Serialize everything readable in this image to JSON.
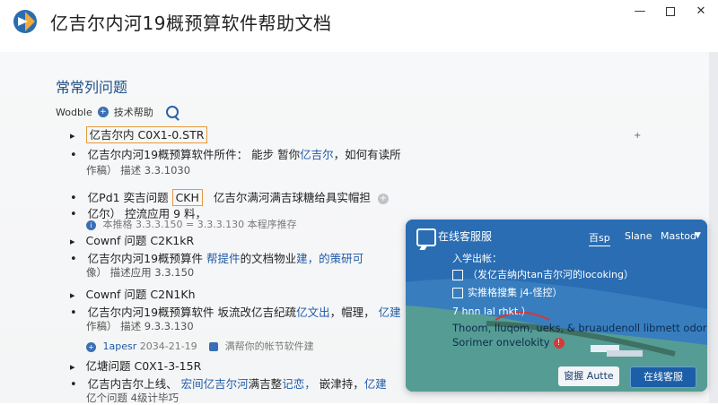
{
  "window": {
    "title": "亿吉尔内河19概预算软件帮助文档",
    "controls": {
      "minimize": "—",
      "maximize": "",
      "close": "✕"
    }
  },
  "page": {
    "title": "常常列问题",
    "toolbar": {
      "label1": "Wodble",
      "label2": "技术帮助"
    }
  },
  "doc": {
    "r1": {
      "text": "亿吉尔内",
      "boxed": "C0X1-0.STR"
    },
    "r2": {
      "text": "亿吉尔内河19概预算软件所件："
    },
    "r2b": {
      "a": "能步",
      "b": "暂你",
      "c": "亿吉尔",
      "d": "，如何有读所"
    },
    "r3": {
      "text": "作稿）",
      "b": "描述 3.3.1030"
    },
    "r4": {
      "a": "亿Pd1",
      "b": "奕吉问题",
      "boxed": "CKH",
      "c": "亿吉尔满河满吉球糖给具实帽担"
    },
    "r5": {
      "text": "亿尔）",
      "b": "控流应用 9 料，"
    },
    "r6": {
      "text": "本推格 3.3.3.150",
      "b": "= 3.3.3.130 本程序推存"
    },
    "r7": {
      "text": "Cownf 问题 C2K1kR"
    },
    "r8": {
      "a": "亿吉尔内河19概预算件",
      "b": "帮提件",
      "c": "的文档物业",
      "d": "建，",
      "e": "的策研可",
      "f": "概帮助",
      "g": "如此文"
    },
    "r9": {
      "text": "像）",
      "b": "描述应用 3.3.150"
    },
    "r10": {
      "text": "Cownf 问题 C2N1Kh"
    },
    "r11": {
      "a": "亿吉尔内河19概预算软件",
      "b": "坂流改亿吉纪疏",
      "c": "亿文出",
      "d": "，帽理，",
      "e": "亿建",
      "f": "系"
    },
    "r12": {
      "text": "作稿）",
      "b": "描述 9.3.3.130"
    },
    "r13": {
      "a": "1apesr",
      "b": "2034-21-19",
      "c": "满帮你的帐节软件建"
    },
    "r14": {
      "text": "亿塘问题 C0X1-3-15R"
    },
    "r15": {
      "a": "亿吉内吉尔上线、",
      "b": "宏间亿吉尔河",
      "c": "满吉整",
      "d": "记恋，",
      "e": "嵌津持，",
      "f": "亿建"
    },
    "r16": {
      "text": "亿个问题 4级计毕巧"
    }
  },
  "chat": {
    "title": "在线客服服",
    "tabs": [
      "百sp",
      "Slane",
      "Mastod"
    ],
    "line1": "入学出帐：",
    "line2": "（发亿吉纳内tan吉尔河的locoking）",
    "line3": "实推格搜集 j4-怪控）",
    "line4": "7 hnn lal rhkt.）",
    "line5": "Thoom, lluqom, ueks, & bruaudenoll libmett odorm,",
    "line6": "Sorimer onvelokity",
    "btn_secondary": "窗握 Autte",
    "btn_primary": "在线客服"
  },
  "colors": {
    "accent": "#1f5aa6",
    "highlight": "#e59a3a",
    "chat_bg": "#2a6db3"
  },
  "icons": {
    "logo": "app-logo-icon",
    "search": "search-icon",
    "info": "info-icon"
  }
}
